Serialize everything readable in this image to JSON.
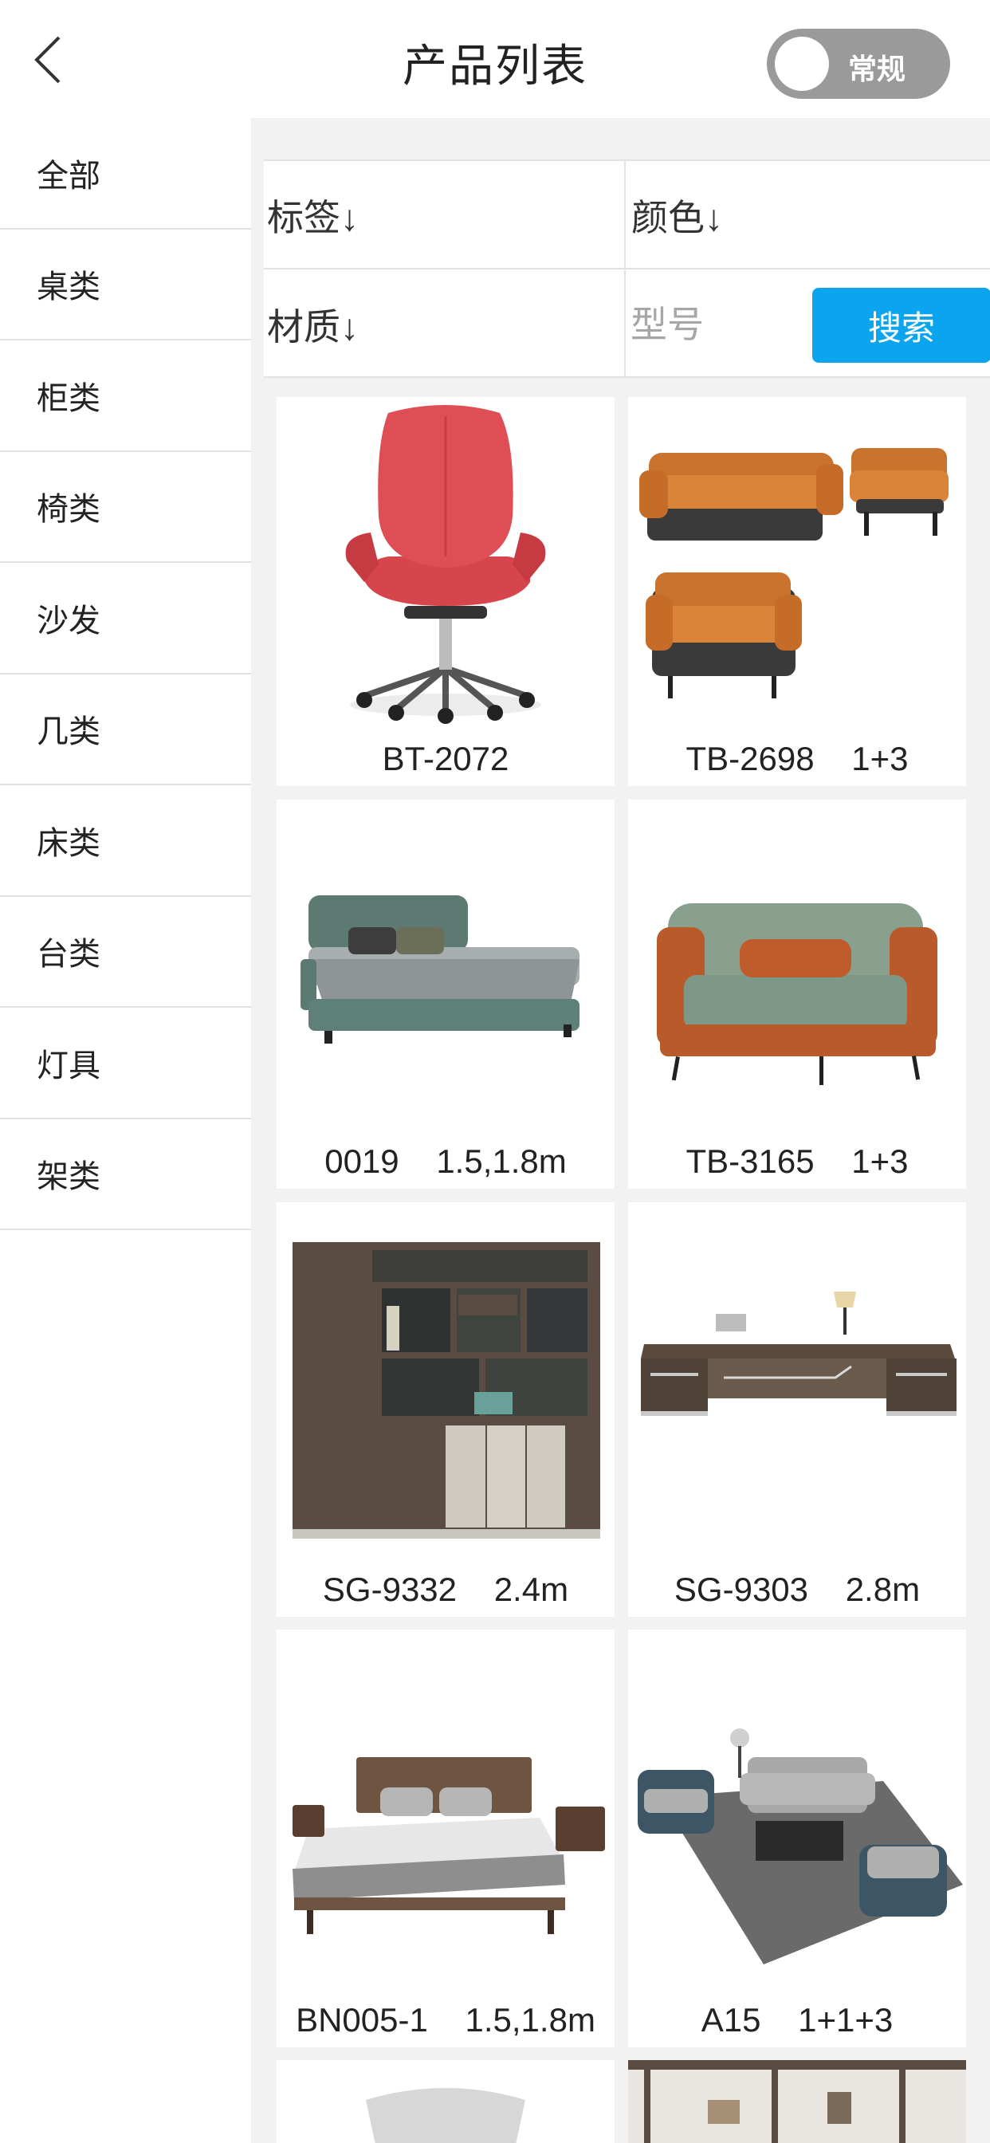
{
  "header": {
    "title": "产品列表",
    "toggle_label": "常规"
  },
  "sidebar": {
    "items": [
      {
        "label": "全部"
      },
      {
        "label": "桌类"
      },
      {
        "label": "柜类"
      },
      {
        "label": "椅类"
      },
      {
        "label": "沙发"
      },
      {
        "label": "几类"
      },
      {
        "label": "床类"
      },
      {
        "label": "台类"
      },
      {
        "label": "灯具"
      },
      {
        "label": "架类"
      }
    ]
  },
  "filters": {
    "tag": "标签↓",
    "color": "颜色↓",
    "material": "材质↓",
    "model_placeholder": "型号",
    "search_label": "搜索"
  },
  "products": [
    {
      "label": "BT-2072",
      "image": "red-office-chair"
    },
    {
      "label": "TB-2698    1+3",
      "image": "orange-sofa-set"
    },
    {
      "label": "0019    1.5,1.8m",
      "image": "green-bed"
    },
    {
      "label": "TB-3165    1+3",
      "image": "green-orange-loveseat"
    },
    {
      "label": "SG-9332    2.4m",
      "image": "bookcase-cabinet"
    },
    {
      "label": "SG-9303    2.8m",
      "image": "executive-desk"
    },
    {
      "label": "BN005-1    1.5,1.8m",
      "image": "wooden-bed"
    },
    {
      "label": "A15    1+1+3",
      "image": "sofa-living-set"
    },
    {
      "label": "",
      "image": "chair-partial"
    },
    {
      "label": "",
      "image": "shelf-partial"
    }
  ]
}
